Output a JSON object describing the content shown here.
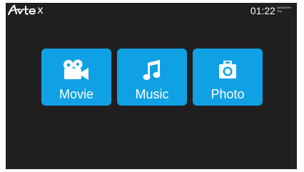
{
  "brand": {
    "logo_tail": "x"
  },
  "status": {
    "time": "01:22",
    "date": "01/01/1970",
    "day": "Thu"
  },
  "menu": {
    "items": [
      {
        "label": "Movie",
        "icon": "movie-camera-icon"
      },
      {
        "label": "Music",
        "icon": "music-note-icon"
      },
      {
        "label": "Photo",
        "icon": "photo-camera-icon"
      }
    ]
  },
  "colors": {
    "background": "#201e1e",
    "tile": "#10a1e4",
    "text": "#ffffff"
  }
}
